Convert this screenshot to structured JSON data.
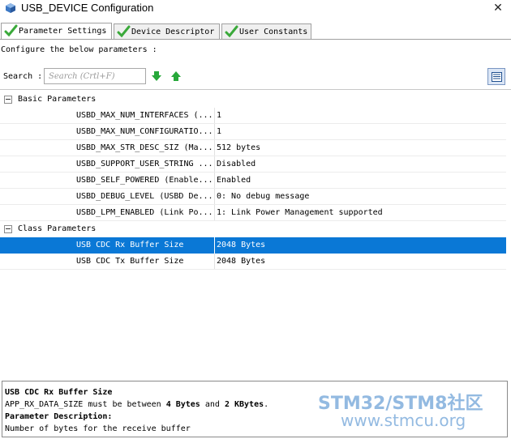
{
  "window": {
    "title": "USB_DEVICE Configuration",
    "close_glyph": "✕"
  },
  "tabs": [
    {
      "label": "Parameter Settings",
      "icon": "check-icon"
    },
    {
      "label": "Device Descriptor",
      "icon": "check-icon"
    },
    {
      "label": "User Constants",
      "icon": "check-icon"
    }
  ],
  "config_label": "Configure the below parameters :",
  "search": {
    "label": "Search :",
    "placeholder": "Search (Crtl+F)"
  },
  "colors": {
    "accent": "#0a78d6",
    "check": "#3aa93a",
    "arrow": "#27a83a",
    "watermark": "#6fa3d8"
  },
  "tree": {
    "basic": {
      "label": "Basic Parameters",
      "rows": [
        {
          "name": "USBD_MAX_NUM_INTERFACES (...",
          "value": "1"
        },
        {
          "name": "USBD_MAX_NUM_CONFIGURATIO...",
          "value": "1"
        },
        {
          "name": "USBD_MAX_STR_DESC_SIZ (Ma...",
          "value": "512 bytes"
        },
        {
          "name": "USBD_SUPPORT_USER_STRING ...",
          "value": "Disabled"
        },
        {
          "name": "USBD_SELF_POWERED (Enable...",
          "value": "Enabled"
        },
        {
          "name": "USBD_DEBUG_LEVEL (USBD De...",
          "value": "0: No debug message"
        },
        {
          "name": "USBD_LPM_ENABLED (Link Po...",
          "value": "1: Link Power Management supported"
        }
      ]
    },
    "class": {
      "label": "Class Parameters",
      "rows": [
        {
          "name": "USB CDC Rx Buffer Size",
          "value": "2048 Bytes"
        },
        {
          "name": "USB CDC Tx Buffer Size",
          "value": "2048 Bytes"
        }
      ]
    }
  },
  "description": {
    "title": "USB CDC Rx Buffer Size",
    "line_prefix": "APP_RX_DATA_SIZE must be between ",
    "line_min": "4 Bytes",
    "line_and": " and ",
    "line_max": "2 KBytes",
    "line_end": ".",
    "param_heading": "Parameter Description:",
    "param_text": "Number of bytes for the receive buffer"
  },
  "watermark": {
    "line1": "STM32/STM8社区",
    "line2": "www.stmcu.org"
  }
}
